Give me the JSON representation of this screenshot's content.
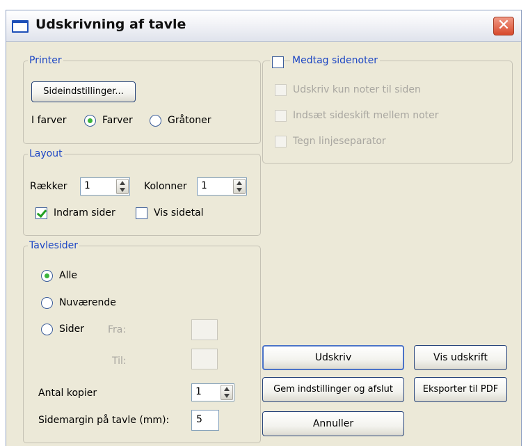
{
  "window": {
    "title": "Udskrivning af tavle",
    "close_glyph": "✕"
  },
  "printer": {
    "legend": "Printer",
    "page_setup_button": "Sideindstillinger...",
    "color_label": "I farver",
    "color_option": "Farver",
    "gray_option": "Gråtoner",
    "selected": "Farver"
  },
  "layout": {
    "legend": "Layout",
    "rows_label": "Rækker",
    "rows_value": "1",
    "cols_label": "Kolonner",
    "cols_value": "1",
    "frame_pages_label": "Indram sider",
    "frame_pages_checked": true,
    "show_page_number_label": "Vis sidetal",
    "show_page_number_checked": false
  },
  "board_pages": {
    "legend": "Tavlesider",
    "all_label": "Alle",
    "current_label": "Nuværende",
    "pages_label": "Sider",
    "from_label": "Fra:",
    "to_label": "Til:",
    "selected": "Alle",
    "copies_label": "Antal kopier",
    "copies_value": "1",
    "margin_label": "Sidemargin på tavle (mm):",
    "margin_value": "5"
  },
  "notes": {
    "legend": "Medtag sidenoter",
    "include_checked": false,
    "opt_only_page_notes": "Udskriv kun noter til siden",
    "opt_page_break": "Indsæt sideskift mellem noter",
    "opt_line_separator": "Tegn linjeseparator"
  },
  "buttons": {
    "print": "Udskriv",
    "preview": "Vis udskrift",
    "save_exit": "Gem indstillinger og afslut",
    "export_pdf": "Eksporter til PDF",
    "cancel": "Annuller"
  }
}
